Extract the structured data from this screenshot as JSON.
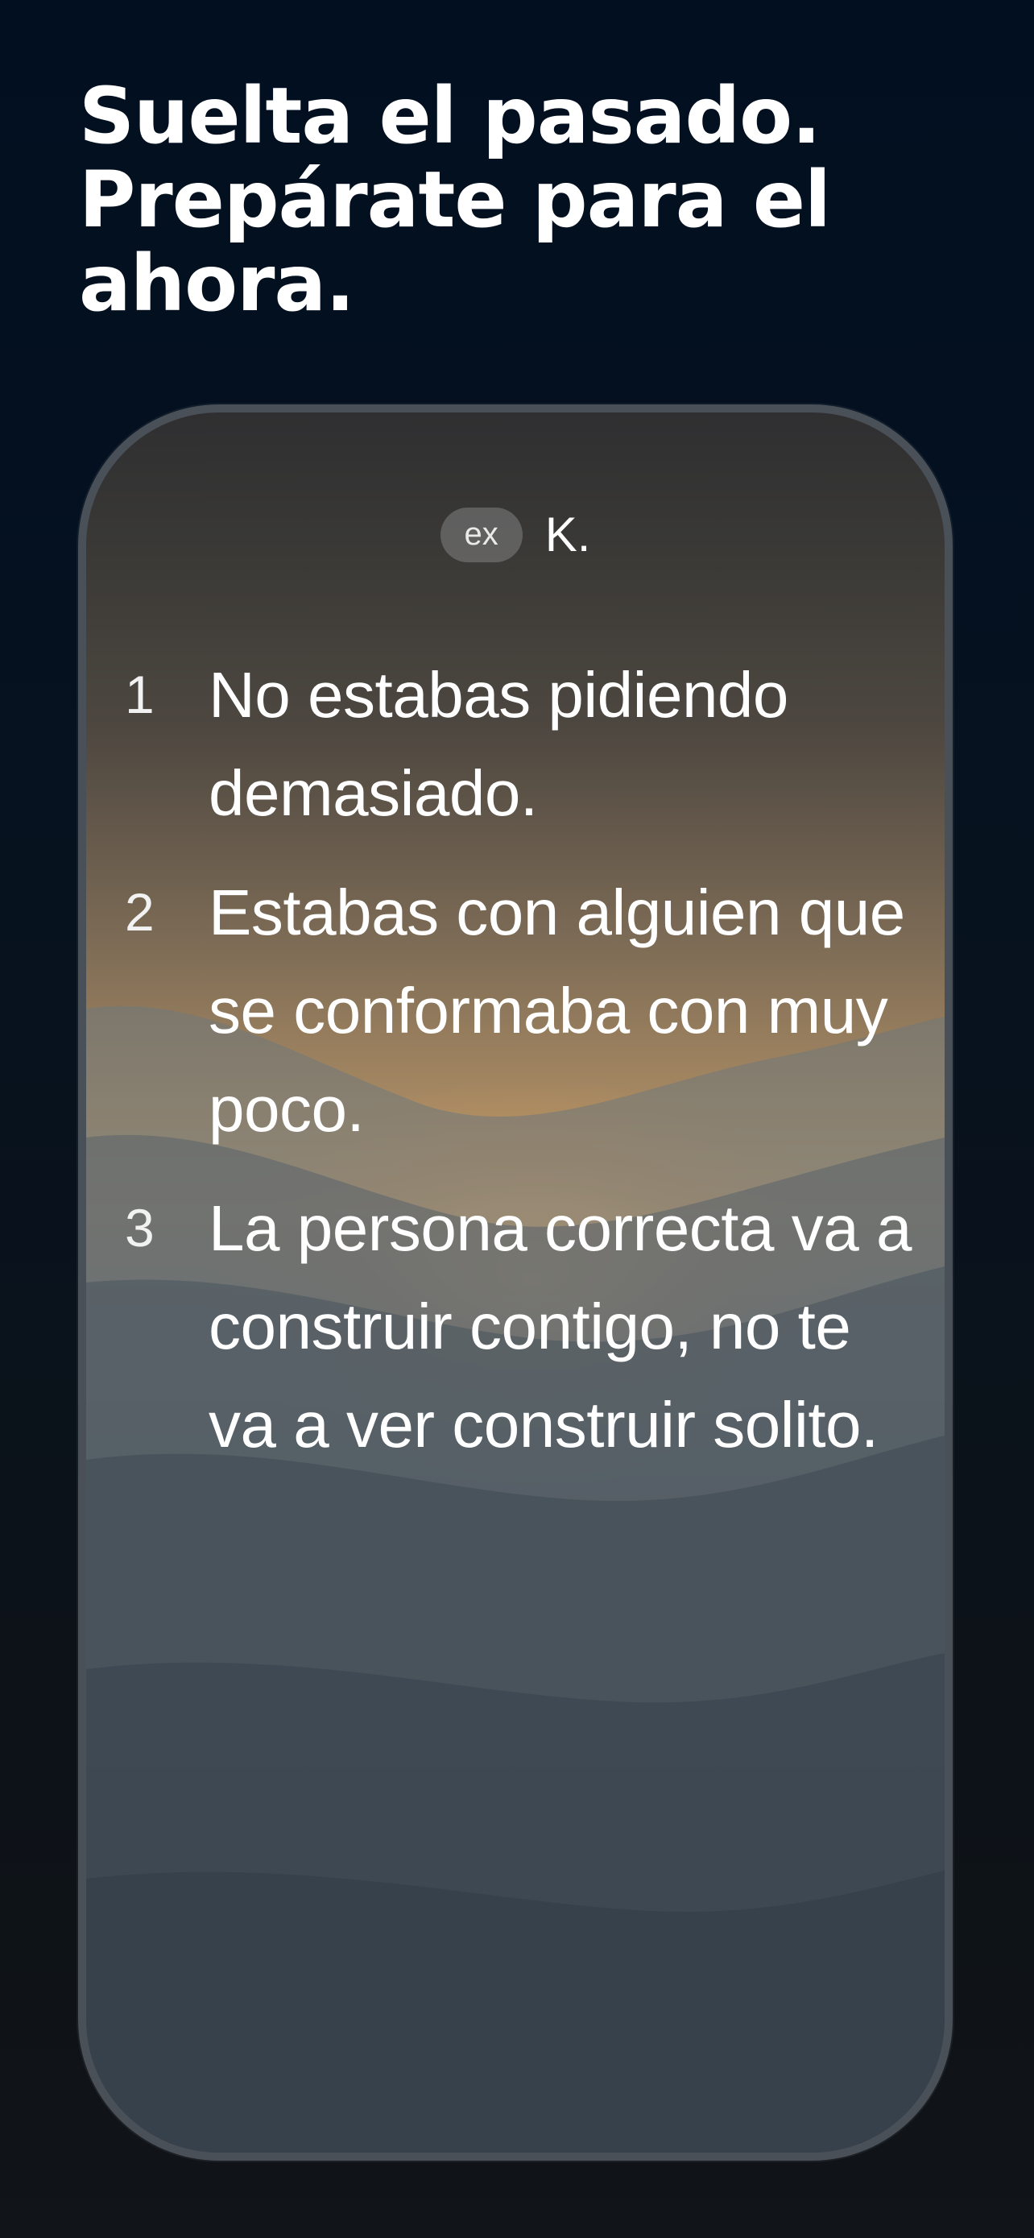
{
  "headline": {
    "text": "Suelta el pasado. Prepárate para el ahora."
  },
  "message": {
    "sender_tag": "ex",
    "sender_name": "K.",
    "items": [
      {
        "number": "1",
        "text": "No estabas pidiendo demasiado."
      },
      {
        "number": "2",
        "text": "Estabas con alguien que se conformaba con muy poco."
      },
      {
        "number": "3",
        "text": "La persona correcta va a construir contigo, no te va a ver construir solito."
      }
    ]
  },
  "colors": {
    "background": "#010f20",
    "text": "#ffffff",
    "frame": "#4a5058"
  }
}
